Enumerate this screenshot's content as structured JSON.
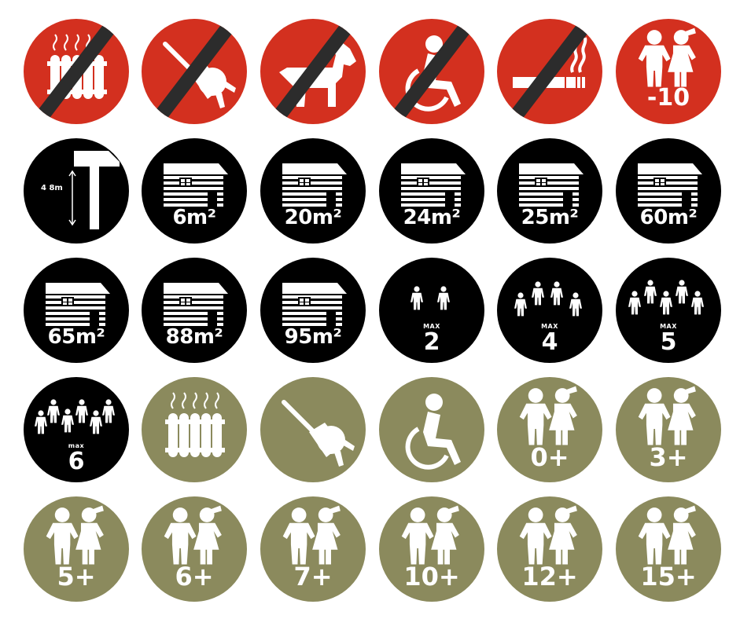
{
  "palette": {
    "red": "#d3301f",
    "black": "#000000",
    "olive": "#8b8a5d",
    "slash": "#2c2c2c",
    "white": "#ffffff"
  },
  "rows": [
    [
      {
        "icon": "no-heating-icon",
        "bg": "red"
      },
      {
        "icon": "no-electricity-icon",
        "bg": "red"
      },
      {
        "icon": "no-pets-icon",
        "bg": "red"
      },
      {
        "icon": "no-wheelchair-icon",
        "bg": "red"
      },
      {
        "icon": "no-smoking-icon",
        "bg": "red"
      },
      {
        "icon": "no-children-under-10-icon",
        "bg": "red",
        "label": "-10"
      }
    ],
    [
      {
        "icon": "ceiling-height-icon",
        "bg": "black",
        "label": "4 8m"
      },
      {
        "icon": "cabin-area-icon",
        "bg": "black",
        "label": "6m²"
      },
      {
        "icon": "cabin-area-icon",
        "bg": "black",
        "label": "20m²"
      },
      {
        "icon": "cabin-area-icon",
        "bg": "black",
        "label": "24m²"
      },
      {
        "icon": "cabin-area-icon",
        "bg": "black",
        "label": "25m²"
      },
      {
        "icon": "cabin-area-icon",
        "bg": "black",
        "label": "60m²"
      }
    ],
    [
      {
        "icon": "cabin-area-icon",
        "bg": "black",
        "label": "65m²"
      },
      {
        "icon": "cabin-area-icon",
        "bg": "black",
        "label": "88m²"
      },
      {
        "icon": "cabin-area-icon",
        "bg": "black",
        "label": "95m²"
      },
      {
        "icon": "max-persons-icon",
        "bg": "black",
        "max": "MAX",
        "label": "2"
      },
      {
        "icon": "max-persons-icon",
        "bg": "black",
        "max": "MAX",
        "label": "4"
      },
      {
        "icon": "max-persons-icon",
        "bg": "black",
        "max": "MAX",
        "label": "5"
      }
    ],
    [
      {
        "icon": "max-persons-icon",
        "bg": "black",
        "max": "max",
        "label": "6"
      },
      {
        "icon": "heating-icon",
        "bg": "olive"
      },
      {
        "icon": "electricity-icon",
        "bg": "olive"
      },
      {
        "icon": "wheelchair-icon",
        "bg": "olive"
      },
      {
        "icon": "children-age-icon",
        "bg": "olive",
        "label": "0+"
      },
      {
        "icon": "children-age-icon",
        "bg": "olive",
        "label": "3+"
      }
    ],
    [
      {
        "icon": "children-age-icon",
        "bg": "olive",
        "label": "5+"
      },
      {
        "icon": "children-age-icon",
        "bg": "olive",
        "label": "6+"
      },
      {
        "icon": "children-age-icon",
        "bg": "olive",
        "label": "7+"
      },
      {
        "icon": "children-age-icon",
        "bg": "olive",
        "label": "10+"
      },
      {
        "icon": "children-age-icon",
        "bg": "olive",
        "label": "12+"
      },
      {
        "icon": "children-age-icon",
        "bg": "olive",
        "label": "15+"
      }
    ]
  ]
}
